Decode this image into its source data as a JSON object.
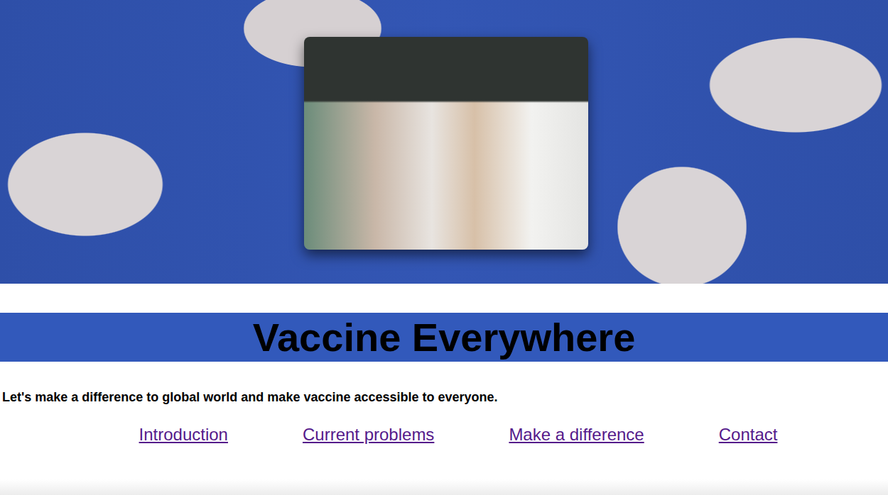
{
  "page": {
    "title": "Vaccine Everywhere",
    "tagline": "Let's make a difference to global world and make vaccine accessible to everyone."
  },
  "nav": [
    {
      "label": "Introduction",
      "visited": true
    },
    {
      "label": "Current problems",
      "visited": true
    },
    {
      "label": "Make a difference",
      "visited": true
    },
    {
      "label": "Contact",
      "visited": true
    }
  ]
}
